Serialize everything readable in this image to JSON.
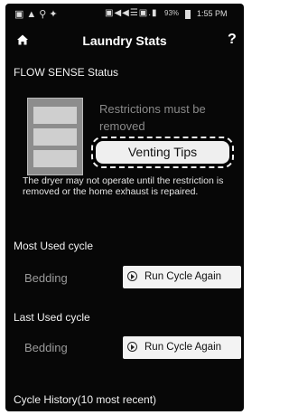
{
  "status_bar": {
    "left_icons": "▣▲⚲✦",
    "icons": "▣◀◀☰▣.▮",
    "battery": "93%",
    "time": "1:55 PM"
  },
  "header": {
    "title": "Laundry Stats",
    "help": "?"
  },
  "flow_sense": {
    "heading": "FLOW SENSE Status",
    "status_text": "Restrictions must be removed",
    "venting_button": "Venting Tips",
    "warning": "The dryer may not operate until the restriction is removed or the home exhaust is repaired."
  },
  "most_used": {
    "heading": "Most Used cycle",
    "cycle": "Bedding",
    "button": "Run Cycle Again"
  },
  "last_used": {
    "heading": "Last Used cycle",
    "cycle": "Bedding",
    "button": "Run Cycle Again"
  },
  "history": {
    "heading": "Cycle History(10 most recent)"
  }
}
